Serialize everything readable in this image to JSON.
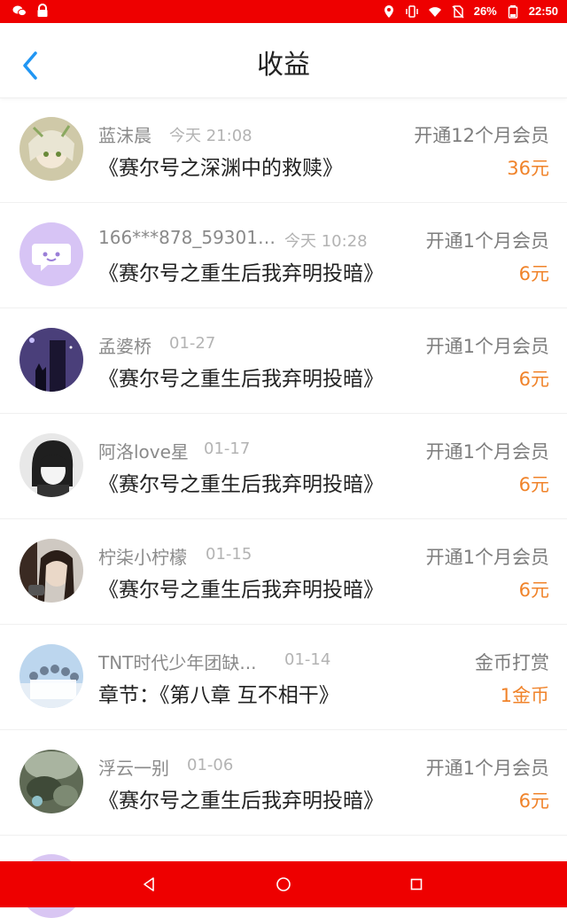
{
  "status_bar": {
    "battery": "26%",
    "time": "22:50",
    "left_icons": [
      "wechat-icon",
      "lock-icon"
    ],
    "right_icons": [
      "location-icon",
      "vibrate-icon",
      "wifi-icon",
      "no-sim-icon",
      "battery-icon"
    ]
  },
  "header": {
    "title": "收益",
    "back_icon": "chevron-left-icon"
  },
  "records": [
    {
      "name": "蓝沫晨",
      "time": "今天 21:08",
      "type": "开通12个月会员",
      "book": "《赛尔号之深渊中的救赎》",
      "amount": "36元"
    },
    {
      "name": "166***878_593018...",
      "time": "今天 10:28",
      "type": "开通1个月会员",
      "book": "《赛尔号之重生后我弃明投暗》",
      "amount": "6元"
    },
    {
      "name": "孟婆桥",
      "time": "01-27",
      "type": "开通1个月会员",
      "book": "《赛尔号之重生后我弃明投暗》",
      "amount": "6元"
    },
    {
      "name": "阿洛love星",
      "time": "01-17",
      "type": "开通1个月会员",
      "book": "《赛尔号之重生后我弃明投暗》",
      "amount": "6元"
    },
    {
      "name": "柠柒小柠檬",
      "time": "01-15",
      "type": "开通1个月会员",
      "book": "《赛尔号之重生后我弃明投暗》",
      "amount": "6元"
    },
    {
      "name": "TNT时代少年团缺...",
      "time": "01-14",
      "type": "金币打赏",
      "book": "章节：《第八章 互不相干》",
      "amount": "1金币"
    },
    {
      "name": "浮云一别",
      "time": "01-06",
      "type": "开通1个月会员",
      "book": "《赛尔号之重生后我弃明投暗》",
      "amount": "6元"
    }
  ],
  "colors": {
    "status_bar": "#ee0000",
    "nav_bar": "#ee0000",
    "accent_blue": "#2196f3",
    "amount_orange": "#f0832a"
  },
  "nav_bar": {
    "icons": [
      "back-triangle-icon",
      "home-circle-icon",
      "recents-square-icon"
    ]
  }
}
